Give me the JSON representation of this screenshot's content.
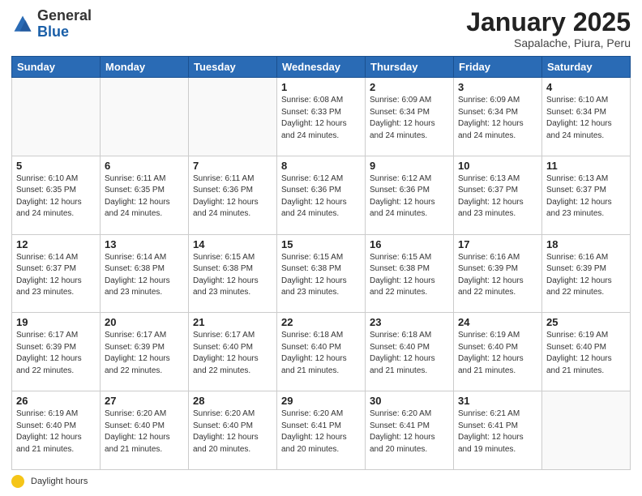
{
  "header": {
    "logo_general": "General",
    "logo_blue": "Blue",
    "month": "January 2025",
    "location": "Sapalache, Piura, Peru"
  },
  "days_of_week": [
    "Sunday",
    "Monday",
    "Tuesday",
    "Wednesday",
    "Thursday",
    "Friday",
    "Saturday"
  ],
  "footer_label": "Daylight hours",
  "weeks": [
    [
      {
        "day": "",
        "info": ""
      },
      {
        "day": "",
        "info": ""
      },
      {
        "day": "",
        "info": ""
      },
      {
        "day": "1",
        "info": "Sunrise: 6:08 AM\nSunset: 6:33 PM\nDaylight: 12 hours and 24 minutes."
      },
      {
        "day": "2",
        "info": "Sunrise: 6:09 AM\nSunset: 6:34 PM\nDaylight: 12 hours and 24 minutes."
      },
      {
        "day": "3",
        "info": "Sunrise: 6:09 AM\nSunset: 6:34 PM\nDaylight: 12 hours and 24 minutes."
      },
      {
        "day": "4",
        "info": "Sunrise: 6:10 AM\nSunset: 6:34 PM\nDaylight: 12 hours and 24 minutes."
      }
    ],
    [
      {
        "day": "5",
        "info": "Sunrise: 6:10 AM\nSunset: 6:35 PM\nDaylight: 12 hours and 24 minutes."
      },
      {
        "day": "6",
        "info": "Sunrise: 6:11 AM\nSunset: 6:35 PM\nDaylight: 12 hours and 24 minutes."
      },
      {
        "day": "7",
        "info": "Sunrise: 6:11 AM\nSunset: 6:36 PM\nDaylight: 12 hours and 24 minutes."
      },
      {
        "day": "8",
        "info": "Sunrise: 6:12 AM\nSunset: 6:36 PM\nDaylight: 12 hours and 24 minutes."
      },
      {
        "day": "9",
        "info": "Sunrise: 6:12 AM\nSunset: 6:36 PM\nDaylight: 12 hours and 24 minutes."
      },
      {
        "day": "10",
        "info": "Sunrise: 6:13 AM\nSunset: 6:37 PM\nDaylight: 12 hours and 23 minutes."
      },
      {
        "day": "11",
        "info": "Sunrise: 6:13 AM\nSunset: 6:37 PM\nDaylight: 12 hours and 23 minutes."
      }
    ],
    [
      {
        "day": "12",
        "info": "Sunrise: 6:14 AM\nSunset: 6:37 PM\nDaylight: 12 hours and 23 minutes."
      },
      {
        "day": "13",
        "info": "Sunrise: 6:14 AM\nSunset: 6:38 PM\nDaylight: 12 hours and 23 minutes."
      },
      {
        "day": "14",
        "info": "Sunrise: 6:15 AM\nSunset: 6:38 PM\nDaylight: 12 hours and 23 minutes."
      },
      {
        "day": "15",
        "info": "Sunrise: 6:15 AM\nSunset: 6:38 PM\nDaylight: 12 hours and 23 minutes."
      },
      {
        "day": "16",
        "info": "Sunrise: 6:15 AM\nSunset: 6:38 PM\nDaylight: 12 hours and 22 minutes."
      },
      {
        "day": "17",
        "info": "Sunrise: 6:16 AM\nSunset: 6:39 PM\nDaylight: 12 hours and 22 minutes."
      },
      {
        "day": "18",
        "info": "Sunrise: 6:16 AM\nSunset: 6:39 PM\nDaylight: 12 hours and 22 minutes."
      }
    ],
    [
      {
        "day": "19",
        "info": "Sunrise: 6:17 AM\nSunset: 6:39 PM\nDaylight: 12 hours and 22 minutes."
      },
      {
        "day": "20",
        "info": "Sunrise: 6:17 AM\nSunset: 6:39 PM\nDaylight: 12 hours and 22 minutes."
      },
      {
        "day": "21",
        "info": "Sunrise: 6:17 AM\nSunset: 6:40 PM\nDaylight: 12 hours and 22 minutes."
      },
      {
        "day": "22",
        "info": "Sunrise: 6:18 AM\nSunset: 6:40 PM\nDaylight: 12 hours and 21 minutes."
      },
      {
        "day": "23",
        "info": "Sunrise: 6:18 AM\nSunset: 6:40 PM\nDaylight: 12 hours and 21 minutes."
      },
      {
        "day": "24",
        "info": "Sunrise: 6:19 AM\nSunset: 6:40 PM\nDaylight: 12 hours and 21 minutes."
      },
      {
        "day": "25",
        "info": "Sunrise: 6:19 AM\nSunset: 6:40 PM\nDaylight: 12 hours and 21 minutes."
      }
    ],
    [
      {
        "day": "26",
        "info": "Sunrise: 6:19 AM\nSunset: 6:40 PM\nDaylight: 12 hours and 21 minutes."
      },
      {
        "day": "27",
        "info": "Sunrise: 6:20 AM\nSunset: 6:40 PM\nDaylight: 12 hours and 21 minutes."
      },
      {
        "day": "28",
        "info": "Sunrise: 6:20 AM\nSunset: 6:40 PM\nDaylight: 12 hours and 20 minutes."
      },
      {
        "day": "29",
        "info": "Sunrise: 6:20 AM\nSunset: 6:41 PM\nDaylight: 12 hours and 20 minutes."
      },
      {
        "day": "30",
        "info": "Sunrise: 6:20 AM\nSunset: 6:41 PM\nDaylight: 12 hours and 20 minutes."
      },
      {
        "day": "31",
        "info": "Sunrise: 6:21 AM\nSunset: 6:41 PM\nDaylight: 12 hours and 19 minutes."
      },
      {
        "day": "",
        "info": ""
      }
    ]
  ]
}
